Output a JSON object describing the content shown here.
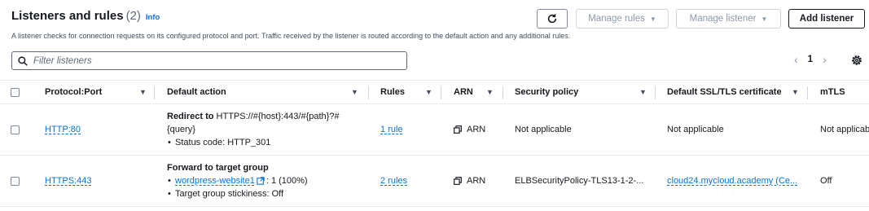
{
  "header": {
    "title": "Listeners and rules",
    "count": "(2)",
    "info": "Info",
    "description": "A listener checks for connection requests on its configured protocol and port. Traffic received by the listener is routed according to the default action and any additional rules."
  },
  "toolbar": {
    "manage_rules": "Manage rules",
    "manage_listener": "Manage listener",
    "add_listener": "Add listener"
  },
  "search": {
    "placeholder": "Filter listeners"
  },
  "pagination": {
    "current_page": "1"
  },
  "table": {
    "columns": [
      "Protocol:Port",
      "Default action",
      "Rules",
      "ARN",
      "Security policy",
      "Default SSL/TLS certificate",
      "mTLS"
    ],
    "rows": [
      {
        "protocol_port": "HTTP:80",
        "action_title": "Redirect to",
        "action_target": "HTTPS://#{host}:443/#{path}?#{query}",
        "action_detail": "Status code: HTTP_301",
        "rules": "1 rule",
        "arn": "ARN",
        "security_policy": "Not applicable",
        "certificate": "Not applicable",
        "mtls": "Not applicab"
      },
      {
        "protocol_port": "HTTPS:443",
        "action_title": "Forward to target group",
        "target_group": "wordpress-website1",
        "target_weight": ": 1 (100%)",
        "action_detail": "Target group stickiness: Off",
        "rules": "2 rules",
        "arn": "ARN",
        "security_policy": "ELBSecurityPolicy-TLS13-1-2-...",
        "certificate": "cloud24.mycloud.academy (Ce...",
        "mtls": "Off"
      }
    ]
  },
  "colors": {
    "link": "#0972d3",
    "text": "#16191f",
    "secondary_text": "#5f6b7a",
    "border": "#e9ebed"
  }
}
